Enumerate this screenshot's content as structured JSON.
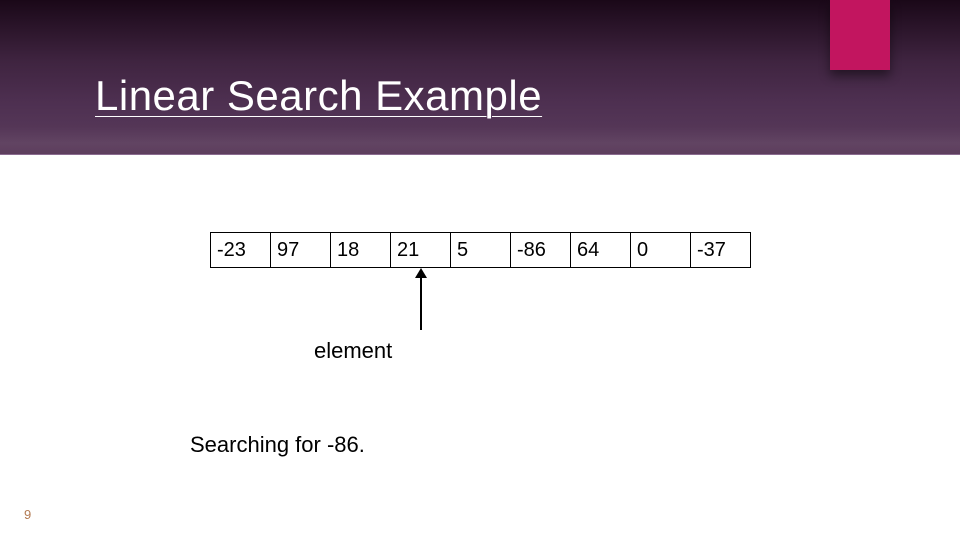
{
  "slide": {
    "title": "Linear Search Example",
    "page_number": "9"
  },
  "array": {
    "cells": [
      "-23",
      "97",
      "18",
      "21",
      "5",
      "-86",
      "64",
      "0",
      "-37"
    ],
    "pointer_index": 3,
    "pointer_label": "element"
  },
  "caption": "Searching for -86.",
  "colors": {
    "accent": "#c2155f",
    "header_dark": "#1a0818",
    "header_light": "#5a3a5a"
  }
}
